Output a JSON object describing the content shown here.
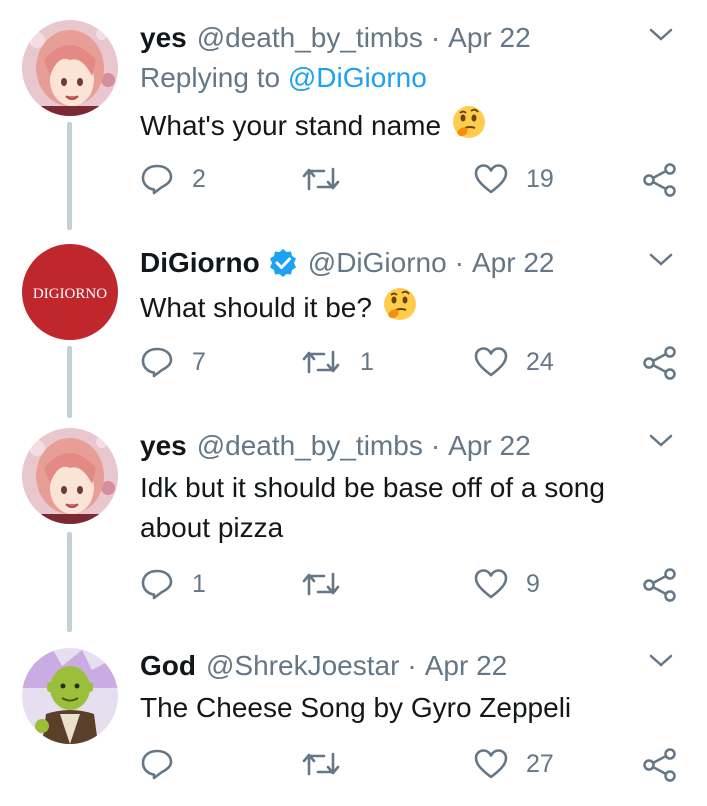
{
  "colors": {
    "text": "#14171a",
    "muted": "#657786",
    "link": "#1da1f2",
    "thread_line": "#c4cfd6",
    "digiorno_red": "#c0272d"
  },
  "tweets": [
    {
      "name": "yes",
      "handle": "@death_by_timbs",
      "date": "Apr 22",
      "replying_prefix": "Replying to",
      "replying_handle": "@DiGiorno",
      "text": "What's your stand name",
      "emoji": "thinking-face",
      "replies": "2",
      "retweets": "",
      "likes": "19"
    },
    {
      "name": "DiGiorno",
      "verified": true,
      "avatar_text": "DIGIORNO",
      "handle": "@DiGiorno",
      "date": "Apr 22",
      "text": "What should it be?",
      "emoji": "thinking-face",
      "replies": "7",
      "retweets": "1",
      "likes": "24"
    },
    {
      "name": "yes",
      "handle": "@death_by_timbs",
      "date": "Apr 22",
      "text_line1": "Idk but it should be base off of a song",
      "text_line2": "about pizza",
      "replies": "1",
      "retweets": "",
      "likes": "9"
    },
    {
      "name": "God",
      "handle": "@ShrekJoestar",
      "date": "Apr 22",
      "text": "The Cheese Song by Gyro Zeppeli",
      "replies": "",
      "retweets": "",
      "likes": "27"
    }
  ]
}
